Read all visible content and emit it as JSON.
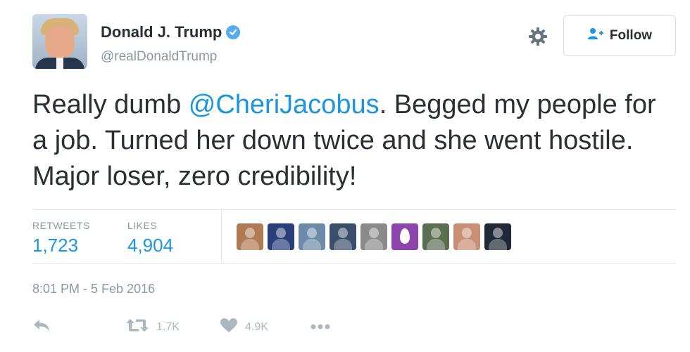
{
  "author": {
    "name": "Donald J. Trump",
    "handle": "@realDonaldTrump",
    "verified": true
  },
  "follow_button": {
    "label": "Follow"
  },
  "tweet": {
    "text_before": "Really dumb ",
    "mention": "@CheriJacobus",
    "text_after": ". Begged my people for a job. Turned her down twice and she went hostile. Major loser, zero credibility!"
  },
  "stats": {
    "retweets_label": "RETWEETS",
    "retweets_value": "1,723",
    "likes_label": "LIKES",
    "likes_value": "4,904"
  },
  "likers": [
    {
      "icon": "woman-avatar",
      "color": "#b07a52"
    },
    {
      "icon": "trump-sign-avatar",
      "color": "#2a3f7a"
    },
    {
      "icon": "person-avatar",
      "color": "#6d8aa8"
    },
    {
      "icon": "jet-avatar",
      "color": "#3a4d6b"
    },
    {
      "icon": "older-man-avatar",
      "color": "#8a8a8a"
    },
    {
      "icon": "default-egg-avatar",
      "color": "#8e44ad"
    },
    {
      "icon": "man-avatar",
      "color": "#5a6e52"
    },
    {
      "icon": "couple-avatar",
      "color": "#c98f74"
    },
    {
      "icon": "news-logo-avatar",
      "color": "#1f2a36"
    }
  ],
  "timestamp": "8:01 PM - 5 Feb 2016",
  "actions": {
    "reply_icon": "reply-icon",
    "retweet_count": "1.7K",
    "like_count": "4.9K",
    "more_icon": "more-icon"
  },
  "colors": {
    "link": "#1b95e0",
    "text": "#292f33",
    "muted": "#8899a6",
    "action_gray": "#aab8c2",
    "verified": "#55acee"
  }
}
